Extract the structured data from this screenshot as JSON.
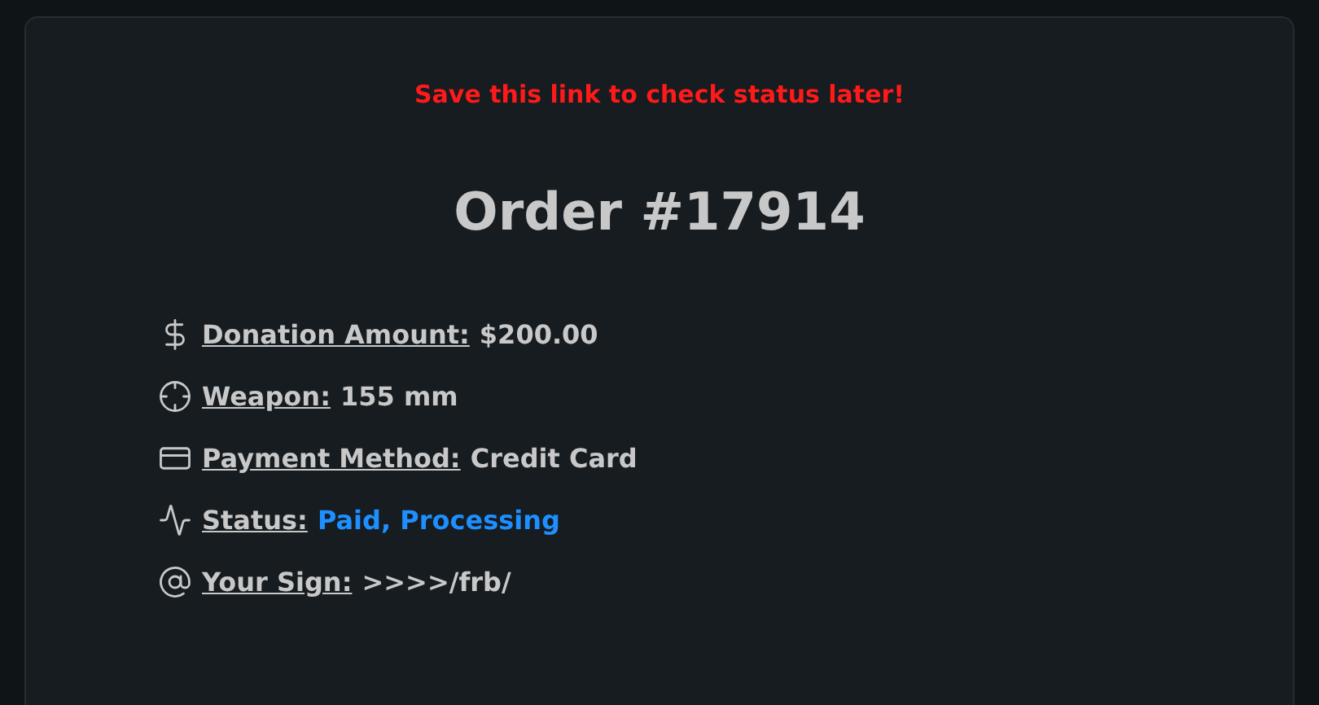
{
  "notice": "Save this link to check status later!",
  "title": "Order #17914",
  "details": [
    {
      "label": "Donation Amount:",
      "value": "$200.00",
      "kind": "plain"
    },
    {
      "label": "Weapon:",
      "value": "155 mm",
      "kind": "plain"
    },
    {
      "label": "Payment Method:",
      "value": "Credit Card",
      "kind": "plain"
    },
    {
      "label": "Status:",
      "value": "Paid, Processing",
      "kind": "status"
    },
    {
      "label": "Your Sign:",
      "value": ">>>>/frb/",
      "kind": "plain"
    }
  ]
}
